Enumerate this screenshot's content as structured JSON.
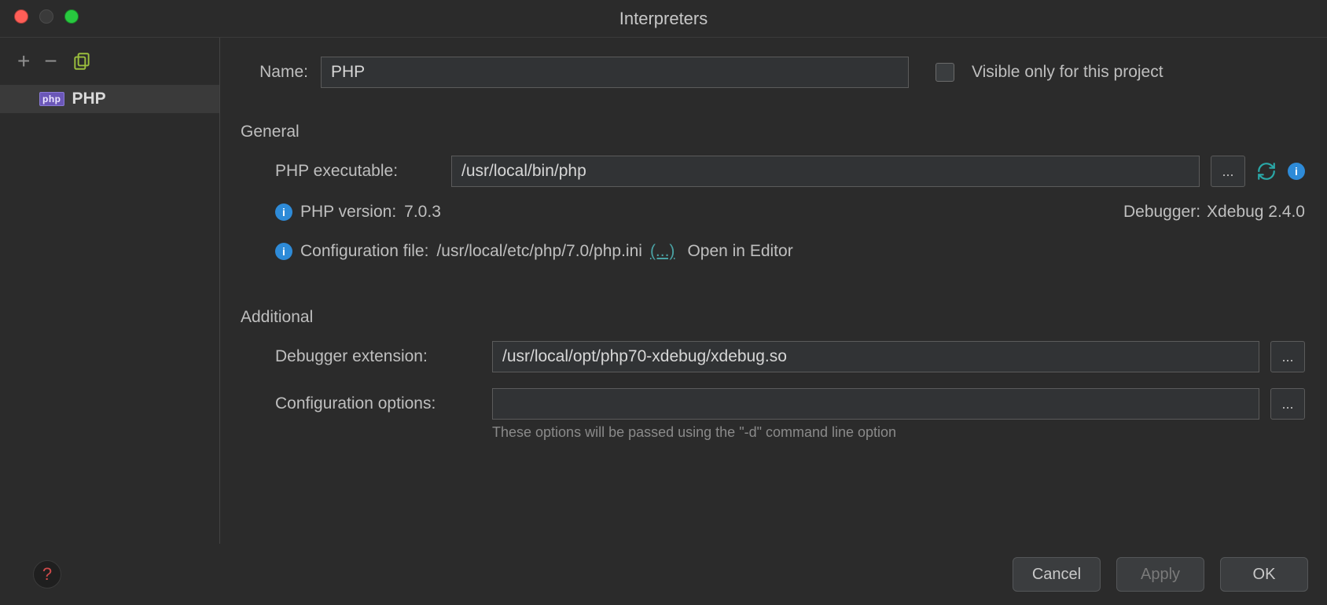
{
  "window": {
    "title": "Interpreters"
  },
  "sidebar": {
    "tools": {
      "add_name": "add",
      "remove_name": "remove",
      "copy_name": "copy"
    },
    "items": [
      {
        "badge": "php",
        "label": "PHP",
        "selected": true
      }
    ]
  },
  "form": {
    "name_label": "Name:",
    "name_value": "PHP",
    "visible_only_label": "Visible only for this project",
    "visible_only_checked": false
  },
  "general": {
    "title": "General",
    "php_exec_label": "PHP executable:",
    "php_exec_value": "/usr/local/bin/php",
    "ellipsis": "...",
    "php_version_label": "PHP version:",
    "php_version_value": "7.0.3",
    "debugger_label": "Debugger:",
    "debugger_value": "Xdebug 2.4.0",
    "config_file_label": "Configuration file:",
    "config_file_value": "/usr/local/etc/php/7.0/php.ini",
    "config_more_link": "(...)",
    "open_in_editor": "Open in Editor"
  },
  "additional": {
    "title": "Additional",
    "debugger_ext_label": "Debugger extension:",
    "debugger_ext_value": "/usr/local/opt/php70-xdebug/xdebug.so",
    "config_opts_label": "Configuration options:",
    "config_opts_value": "",
    "hint": "These options will be passed using the \"-d\" command line option",
    "ellipsis": "..."
  },
  "footer": {
    "cancel": "Cancel",
    "apply": "Apply",
    "ok": "OK"
  }
}
